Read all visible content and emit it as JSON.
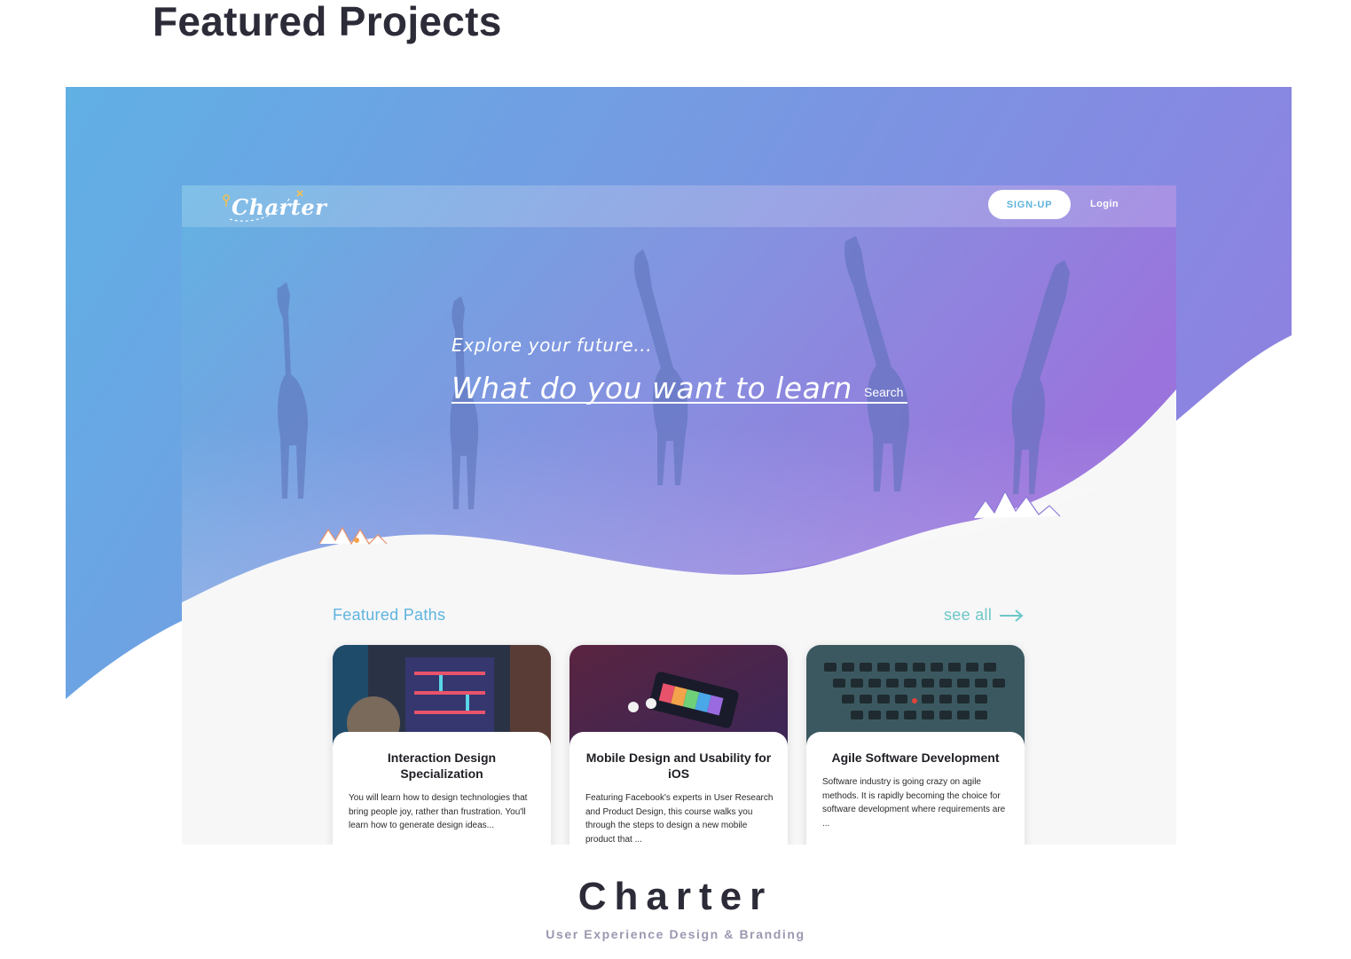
{
  "section": {
    "title": "Featured Projects"
  },
  "mockup": {
    "nav": {
      "logo_text": "Charter",
      "signup_label": "SIGN-UP",
      "login_label": "Login"
    },
    "hero": {
      "tagline": "Explore your future...",
      "search_placeholder": "What do you want to learn?",
      "search_button": "Search"
    },
    "featured": {
      "title": "Featured Paths",
      "see_all": "see all",
      "cards": [
        {
          "title": "Interaction Design Specialization",
          "description": "You will learn how to design technologies that bring people joy, rather than frustration. You'll learn how to generate design ideas...",
          "image": "arcade-game-photo"
        },
        {
          "title": "Mobile Design and Usability for iOS",
          "description": "Featuring Facebook's experts in User Research and Product Design, this course walks you through the steps to design a new mobile product that ...",
          "image": "iphone-airpods-photo"
        },
        {
          "title": "Agile Software Development",
          "description": "Software industry is going crazy on agile methods.  It is rapidly becoming the choice for software development where requirements are ...",
          "image": "laptop-keyboard-photo"
        }
      ]
    }
  },
  "project": {
    "name": "Charter",
    "subtitle": "User Experience Design & Branding"
  },
  "colors": {
    "gradient_start": "#5fb0e4",
    "gradient_end": "#8b80e0",
    "accent_blue": "#5fb4df",
    "accent_teal": "#6ec7c7",
    "title_dark": "#2c2b38",
    "subtitle_gray": "#9a98b0"
  }
}
